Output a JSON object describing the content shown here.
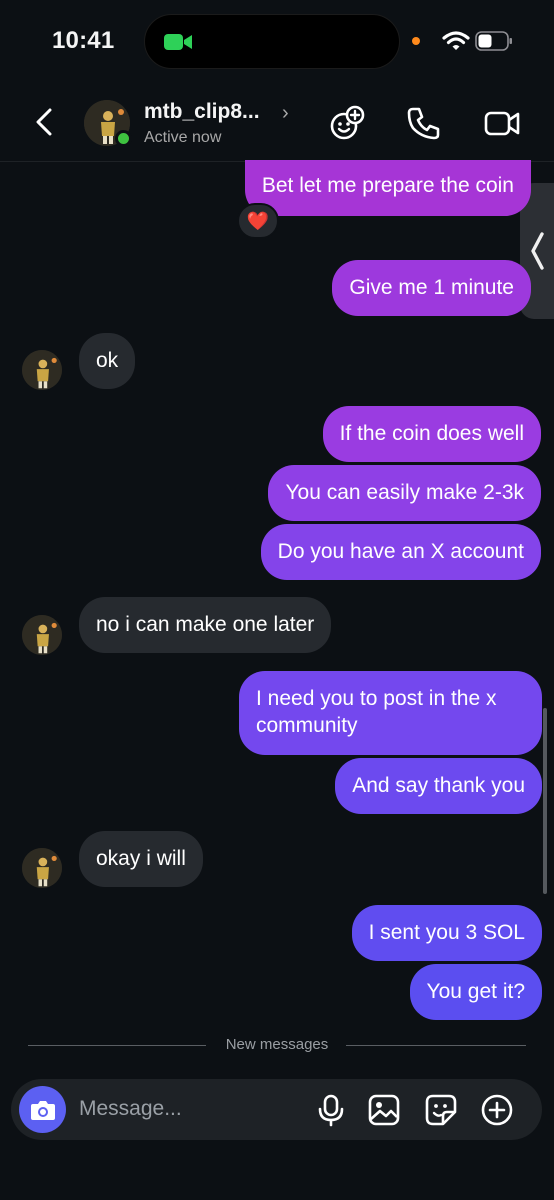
{
  "status_bar": {
    "time": "10:41"
  },
  "header": {
    "contact_name": "mtb_clip8...",
    "contact_status": "Active now"
  },
  "messages": [
    {
      "text": "Bet let me prepare the coin",
      "direction": "out",
      "reaction": "❤️"
    },
    {
      "text": "Give me 1 minute",
      "direction": "out"
    },
    {
      "text": "ok",
      "direction": "in"
    },
    {
      "text": "If the coin does well",
      "direction": "out"
    },
    {
      "text": "You can easily make 2-3k",
      "direction": "out"
    },
    {
      "text": "Do you have an X account",
      "direction": "out"
    },
    {
      "text": "no i can make one later",
      "direction": "in"
    },
    {
      "text": "I need you to post in the x community",
      "direction": "out"
    },
    {
      "text": "And say thank you",
      "direction": "out"
    },
    {
      "text": "okay i will",
      "direction": "in"
    },
    {
      "text": "I sent you 3 SOL",
      "direction": "out"
    },
    {
      "text": "You get it?",
      "direction": "out"
    }
  ],
  "divider": {
    "label": "New messages"
  },
  "composer": {
    "placeholder": "Message..."
  },
  "colors": {
    "background": "#0c1014",
    "incoming_bubble": "#262a2f",
    "outgoing_top": "#a235d9",
    "outgoing_bottom": "#5b4ef0",
    "camera_button": "#5c60f2",
    "online": "#3ec240"
  },
  "icons": [
    "back-icon",
    "emoji-add-icon",
    "phone-icon",
    "video-call-icon",
    "camera-icon",
    "microphone-icon",
    "gallery-icon",
    "sticker-icon",
    "plus-icon",
    "heart-icon"
  ]
}
